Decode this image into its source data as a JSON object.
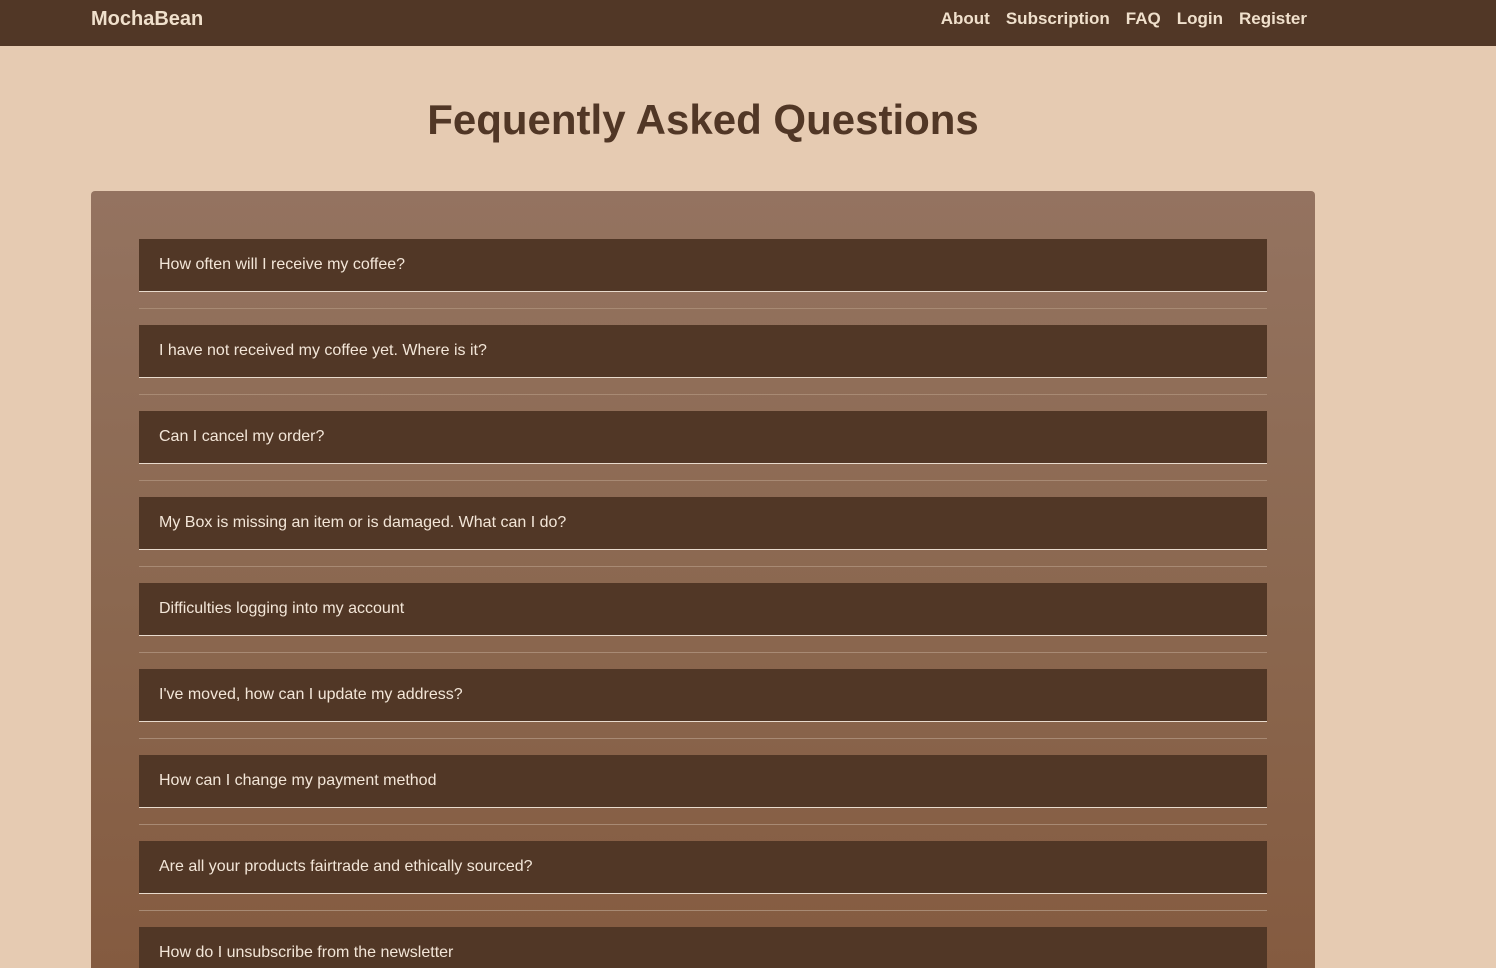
{
  "nav": {
    "brand": "MochaBean",
    "links": [
      "About",
      "Subscription",
      "FAQ",
      "Login",
      "Register"
    ]
  },
  "page": {
    "title": "Fequently Asked Questions"
  },
  "faq": {
    "questions": [
      "How often will I receive my coffee?",
      "I have not received my coffee yet. Where is it?",
      "Can I cancel my order?",
      "My Box is missing an item or is damaged. What can I do?",
      "Difficulties logging into my account",
      "I've moved, how can I update my address?",
      "How can I change my payment method",
      "Are all your products fairtrade and ethically sourced?",
      "How do I unsubscribe from the newsletter"
    ]
  },
  "colors": {
    "nav_bg": "#513726",
    "page_bg": "#e6cbb2",
    "panel_top": "#947360",
    "panel_bottom": "#845a3f",
    "question_bg": "#513726",
    "text_light": "#f3e6d8"
  }
}
